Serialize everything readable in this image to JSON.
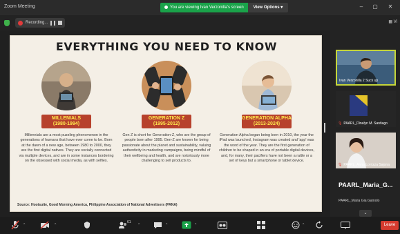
{
  "window": {
    "title": "Zoom Meeting"
  },
  "banner": {
    "status": "You are viewing Ivan Verzonilla's screen",
    "options_label": "View Options"
  },
  "window_controls": {
    "minimize": "–",
    "restore": "▢",
    "close": "✕"
  },
  "recording": {
    "label": "Recording...",
    "view_label": "Vi"
  },
  "slide": {
    "title": "EVERYTHING YOU NEED TO KNOW",
    "columns": [
      {
        "label_line1": "MILLENIALS",
        "label_line2": "(1980-1994)",
        "text": "Millennials are a most puzzling phenomenon in the generations of humans that have ever come to be. Born at the dawn of a new age, between 1980 to 2000, they are the first digital natives. They are socially connected via multiple devices, and are in some instances bordering on the obsessed with social media, as with selfies."
      },
      {
        "label_line1": "GENERATION Z",
        "label_line2": "(1995-2012)",
        "text": "Gen Z is short for Generation-Z, who are the group of people born after 1995. Gen-Z are known for being passionate about the planet and sustainability, valuing authenticity in marketing campaigns, being mindful of their wellbeing and health, and are notoriously more challenging to sell products to."
      },
      {
        "label_line1": "GENERATION ALPHA",
        "label_line2": "(2013-2024)",
        "text": "Generation Alpha began being born in 2010, the year the iPad was launched, Instagram was created and 'app' was the word of the year. They are the first generation of children to be shaped in an era of portable digital devices, and, for many, their pacifiers have not been a rattle or a set of keys but a smartphone or tablet device."
      }
    ],
    "source": "Source: Hootsuite, Good Morning America, Philippine Association of National Advertisers (PANA)"
  },
  "participants": [
    {
      "name": "Ivan Verzonilla 2 Suck up",
      "active": true,
      "muted": false
    },
    {
      "name": "PAARL_Dinalyn M. Santiago",
      "active": false,
      "muted": true
    },
    {
      "name": "PAARL_Anna Lorrizza Sajona",
      "active": false,
      "muted": true
    }
  ],
  "featured_participant": {
    "name": "PAARL_Maria_G...",
    "full_name": "PAARL_Maria Gia Gamolo"
  },
  "toolbar": {
    "participants_count": "61",
    "leave_label": "Leave"
  },
  "colors": {
    "accent_green": "#1aa34a",
    "label_bg": "#b7412c",
    "label_text": "#ffe94d",
    "leave_red": "#d63b2f",
    "active_border": "#c6d63a"
  }
}
